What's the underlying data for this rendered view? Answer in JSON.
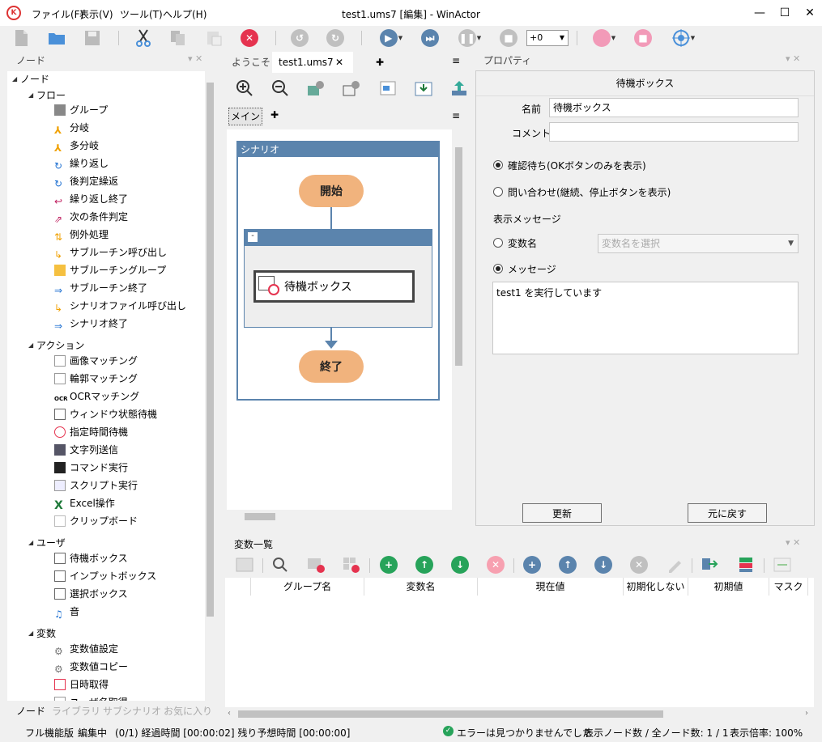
{
  "window": {
    "title": "test1.ums7 [編集] - WinActor",
    "menu": [
      "ファイル(F)",
      "表示(V)",
      "ツール(T)",
      "ヘルプ(H)"
    ],
    "controls": {
      "minimize": "—",
      "maximize": "☐",
      "close": "✕"
    }
  },
  "toolbar": {
    "wait_value": "+0",
    "colors": {
      "play": "#5b84ad",
      "stop_red": "#e5334f",
      "pink": "#f29ab8",
      "disabled": "#c0c0c0"
    }
  },
  "node_panel": {
    "title": "ノード",
    "groups": [
      {
        "label": "ノード"
      },
      {
        "label": "フロー",
        "items": [
          "グループ",
          "分岐",
          "多分岐",
          "繰り返し",
          "後判定繰返",
          "繰り返し終了",
          "次の条件判定",
          "例外処理",
          "サブルーチン呼び出し",
          "サブルーチングループ",
          "サブルーチン終了",
          "シナリオファイル呼び出し",
          "シナリオ終了"
        ]
      },
      {
        "label": "アクション",
        "items": [
          "画像マッチング",
          "輪郭マッチング",
          "OCRマッチング",
          "ウィンドウ状態待機",
          "指定時間待機",
          "文字列送信",
          "コマンド実行",
          "スクリプト実行",
          "Excel操作",
          "クリップボード"
        ]
      },
      {
        "label": "ユーザ",
        "items": [
          "待機ボックス",
          "インプットボックス",
          "選択ボックス",
          "音"
        ]
      },
      {
        "label": "変数",
        "items": [
          "変数値設定",
          "変数値コピー",
          "日時取得",
          "ユーザ名取得"
        ]
      }
    ],
    "bottom_tabs": [
      "ノード",
      "ライブラリ",
      "サブシナリオ",
      "お気に入り"
    ]
  },
  "editor": {
    "tabs": [
      "ようこそ",
      "test1.ums7"
    ],
    "close_glyph": "✕",
    "add_glyph": "✚",
    "subtab": "メイン",
    "scenario_label": "シナリオ",
    "group_label": "-",
    "start_label": "開始",
    "end_label": "終了",
    "node_label": "待機ボックス"
  },
  "properties": {
    "title": "プロパティ",
    "heading": "待機ボックス",
    "name_label": "名前",
    "name_value": "待機ボックス",
    "comment_label": "コメント",
    "comment_value": "",
    "radio_confirm": "確認待ち(OKボタンのみを表示)",
    "radio_inquiry": "問い合わせ(継続、停止ボタンを表示)",
    "message_section": "表示メッセージ",
    "radio_variable": "変数名",
    "variable_placeholder": "変数名を選択",
    "radio_message": "メッセージ",
    "message_text": "test1 を実行しています",
    "update_button": "更新",
    "revert_button": "元に戻す"
  },
  "variables_panel": {
    "title": "変数一覧",
    "columns": [
      "グループ名",
      "変数名",
      "現在値",
      "初期化しない",
      "初期値",
      "マスク"
    ]
  },
  "status": {
    "mode": "フル機能版",
    "state": "編集中",
    "progress": "(0/1) 経過時間 [00:00:02] 残り予想時間 [00:00:00]",
    "errors": "エラーは見つかりませんでした",
    "node_count": "表示ノード数 / 全ノード数: 1 / 1",
    "zoom": "表示倍率: 100%"
  }
}
